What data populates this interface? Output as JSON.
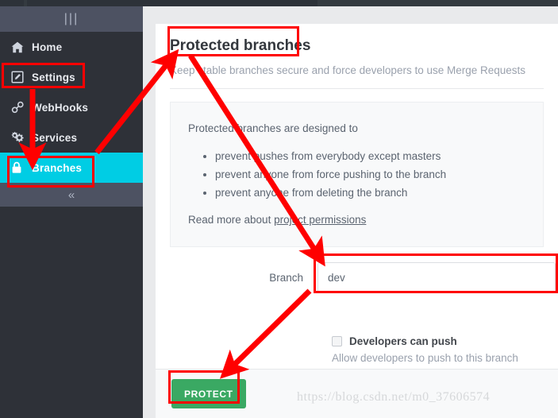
{
  "sidebar": {
    "header_icon": "grip-lines-vertical-icon",
    "items": [
      {
        "label": "Home",
        "icon": "home-icon"
      },
      {
        "label": "Settings",
        "icon": "edit-pencil-square-icon"
      },
      {
        "label": "WebHooks",
        "icon": "link-chain-icon"
      },
      {
        "label": "Services",
        "icon": "gears-icon"
      },
      {
        "label": "Branches",
        "icon": "lock-icon",
        "active": true
      }
    ],
    "collapse_icon": "chevron-double-left-icon",
    "active_color": "#00cde4",
    "background_color": "#2e3138"
  },
  "main": {
    "title": "Protected branches",
    "subtitle": "Keep stable branches secure and force developers to use Merge Requests",
    "well": {
      "intro": "Protected branches are designed to",
      "bullets": [
        "prevent pushes from everybody except masters",
        "prevent anyone from force pushing to the branch",
        "prevent anyone from deleting the branch"
      ],
      "read_more_prefix": "Read more about ",
      "read_more_link": "project permissions"
    },
    "form": {
      "branch_label": "Branch",
      "branch_value": "dev",
      "branch_placeholder": "",
      "checkbox_label": "Developers can push",
      "checkbox_checked": false,
      "checkbox_help": "Allow developers to push to this branch"
    },
    "footer": {
      "protect_label": "PROTECT",
      "protect_color": "#3aa963",
      "watermark": "https://blog.csdn.net/m0_37606574"
    }
  },
  "annotations": {
    "color": "#ff0000",
    "boxes": [
      {
        "name": "settings-highlight"
      },
      {
        "name": "branches-highlight"
      },
      {
        "name": "title-highlight"
      },
      {
        "name": "branch-input-highlight"
      },
      {
        "name": "protect-button-highlight"
      }
    ],
    "arrows": [
      {
        "name": "settings-to-branches-arrow"
      },
      {
        "name": "branches-to-title-arrow"
      },
      {
        "name": "title-to-branch-input-arrow"
      },
      {
        "name": "branch-input-to-protect-arrow"
      }
    ]
  }
}
